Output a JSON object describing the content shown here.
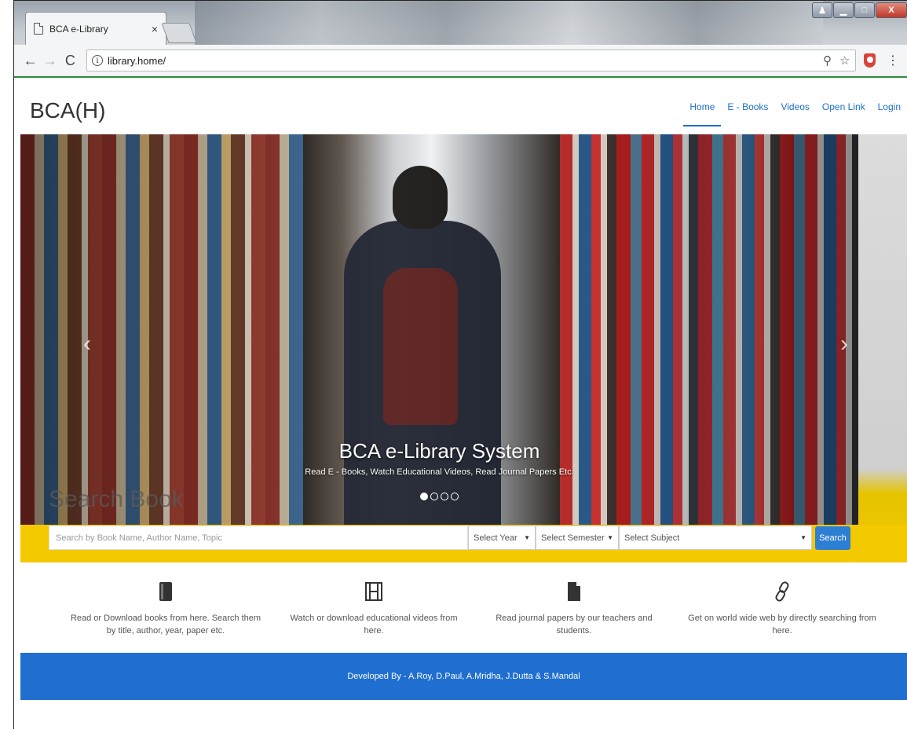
{
  "browser": {
    "tab_title": "BCA e-Library",
    "tab_close": "×",
    "url": "library.home/",
    "back": "←",
    "forward": "→",
    "reload": "C",
    "info": "i",
    "zoom_icon": "⚲",
    "star_icon": "☆",
    "menu": "⋮",
    "win_min": "▁",
    "win_max": "□",
    "win_close": "X",
    "win_user": "♟"
  },
  "navbar": {
    "brand": "BCA(H)",
    "items": [
      {
        "label": "Home",
        "active": true
      },
      {
        "label": "E - Books",
        "active": false
      },
      {
        "label": "Videos",
        "active": false
      },
      {
        "label": "Open Link",
        "active": false
      },
      {
        "label": "Login",
        "active": false
      }
    ]
  },
  "hero": {
    "title": "BCA e-Library System",
    "subtitle": "Read E - Books, Watch Educational Videos, Read Journal Papers Etc.",
    "slides": 4,
    "active_slide": 1,
    "prev": "‹",
    "next": "›",
    "search_heading": "Search Book"
  },
  "search": {
    "placeholder": "Search by Book Name, Author Name, Topic",
    "year": "Select Year",
    "semester": "Select Semester",
    "subject": "Select Subject",
    "caret": "▼",
    "button": "Search"
  },
  "features": [
    {
      "icon": "book-icon",
      "text": "Read or Download books from here. Search them by title, author, year, paper etc."
    },
    {
      "icon": "film-icon",
      "text": "Watch or download educational videos from here."
    },
    {
      "icon": "file-icon",
      "text": "Read journal papers by our teachers and students."
    },
    {
      "icon": "link-icon",
      "text": "Get on world wide web by directly searching from here."
    }
  ],
  "footer": {
    "text": "Developed By - A.Roy, D.Paul, A.Mridha, J.Dutta & S.Mandal"
  },
  "colors": {
    "accent": "#1e6fc7",
    "footer": "#1f6ed0",
    "band": "#f3c900",
    "green": "#2e8b3a"
  }
}
